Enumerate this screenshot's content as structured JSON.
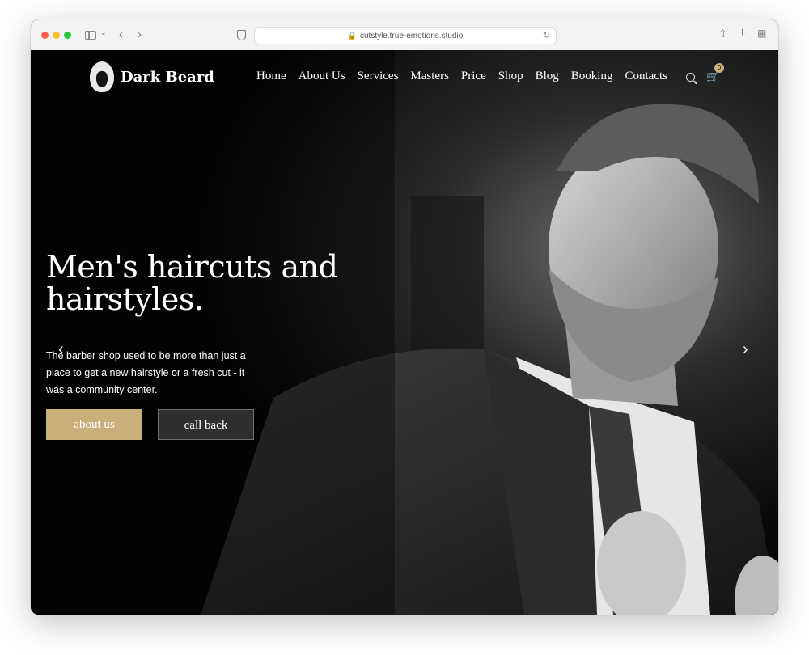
{
  "browser": {
    "url": "cutstyle.true-emotions.studio"
  },
  "site": {
    "logo_text": "Dark Beard",
    "nav": [
      "Home",
      "About Us",
      "Services",
      "Masters",
      "Price",
      "Shop",
      "Blog",
      "Booking",
      "Contacts"
    ],
    "cart_count": "0"
  },
  "hero": {
    "headline": "Men's haircuts and hairstyles.",
    "subtext": "The barber shop used to be more than just a place to get a new hairstyle or a fresh cut - it was a community center.",
    "primary_button": "about us",
    "secondary_button": "call back"
  },
  "colors": {
    "accent": "#c9b07a",
    "background": "#060606"
  }
}
